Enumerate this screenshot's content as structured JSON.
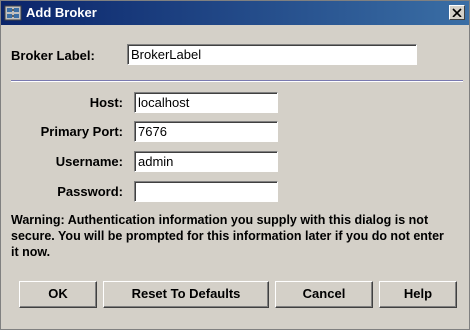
{
  "window": {
    "title": "Add Broker",
    "title_icon": "broker-icon",
    "close_icon": "close-icon"
  },
  "broker_label": {
    "label": "Broker Label:",
    "value": "BrokerLabel"
  },
  "host": {
    "label": "Host:",
    "value": "localhost"
  },
  "primary_port": {
    "label": "Primary Port:",
    "value": "7676"
  },
  "username": {
    "label": "Username:",
    "value": "admin"
  },
  "password": {
    "label": "Password:",
    "value": ""
  },
  "warning": "Warning: Authentication information you supply with this dialog is not secure. You will be prompted for this information later if you do not enter it now.",
  "buttons": {
    "ok": "OK",
    "reset": "Reset To Defaults",
    "cancel": "Cancel",
    "help": "Help"
  },
  "colors": {
    "titlebar_start": "#0a246a",
    "titlebar_end": "#3a6ea5",
    "dialog_bg": "#d4d0c8"
  }
}
